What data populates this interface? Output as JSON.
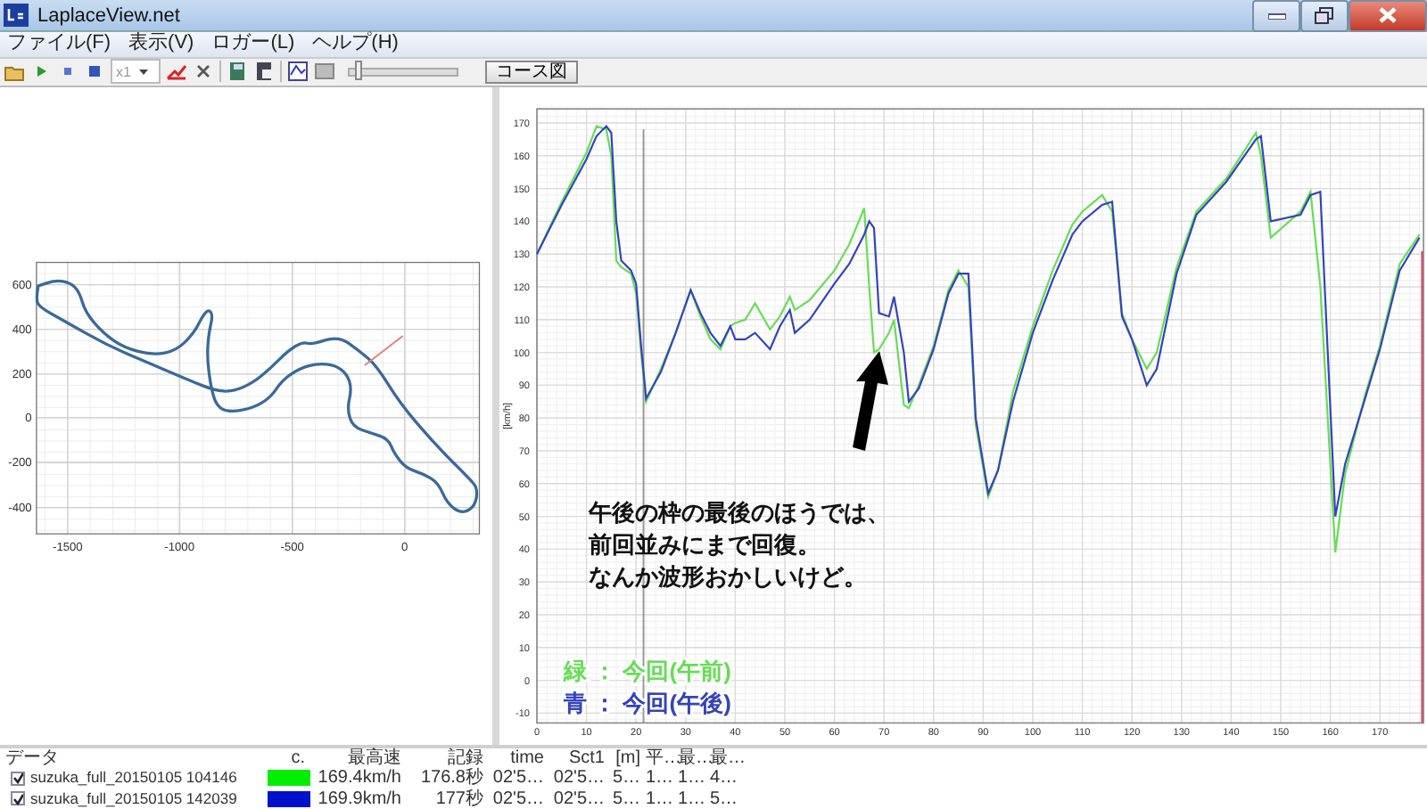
{
  "window": {
    "title": "LaplaceView.net"
  },
  "menu": [
    {
      "label": "ファイル(F)"
    },
    {
      "label": "表示(V)"
    },
    {
      "label": "ロガー(L)"
    },
    {
      "label": "ヘルプ(H)"
    }
  ],
  "toolbar": {
    "zoom_select": "x1",
    "slider": {
      "level": 0.05
    },
    "course_button": "コース図"
  },
  "track_map": {
    "xticks": [
      "-1500",
      "-1000",
      "-500",
      "0"
    ],
    "yticks": [
      "600",
      "400",
      "200",
      "0",
      "-200",
      "-400"
    ]
  },
  "speed_chart": {
    "chart_data": {
      "type": "line",
      "ylabel": "[km/h]",
      "grid": true,
      "ref_lines": [
        {
          "axis": "x",
          "value": 21.5,
          "color": "#999999"
        },
        {
          "axis": "x",
          "value": 178.5,
          "color": "#d04060"
        }
      ],
      "xlim": [
        0,
        178.8
      ],
      "ylim": [
        -13,
        174.3
      ],
      "xticks": [
        0,
        10,
        20,
        30,
        40,
        50,
        60,
        70,
        80,
        90,
        100,
        110,
        120,
        130,
        140,
        150,
        160,
        170
      ],
      "yticks": [
        -10,
        0,
        10,
        20,
        30,
        40,
        50,
        60,
        70,
        80,
        90,
        100,
        110,
        120,
        130,
        140,
        150,
        160,
        170
      ],
      "x": [
        0,
        5,
        10,
        12,
        14,
        15,
        16,
        17,
        19,
        20,
        21,
        22,
        25,
        28,
        31,
        33,
        35,
        37,
        39,
        40,
        42,
        44,
        47,
        49,
        51,
        52,
        55,
        60,
        63,
        66,
        67,
        68,
        69,
        71,
        72,
        74,
        75,
        77,
        80,
        83,
        85,
        87,
        88.5,
        91,
        93,
        96,
        100,
        104,
        108,
        110,
        114,
        116,
        118,
        120,
        123,
        125,
        129,
        133,
        139,
        145,
        146,
        148,
        154,
        156,
        158,
        161,
        163,
        167,
        170,
        174,
        178
      ],
      "series": [
        {
          "name": "今回(午前)",
          "color": "#66dd55",
          "values": [
            130,
            146,
            161,
            169,
            168,
            160,
            128,
            126,
            124,
            118,
            100,
            85,
            95,
            106,
            119,
            111,
            104,
            101,
            108,
            109,
            110,
            115,
            107,
            111,
            117,
            113,
            116,
            125,
            133,
            144,
            120,
            100,
            101,
            106,
            110,
            84,
            83,
            90,
            102,
            119,
            125,
            120,
            78,
            56,
            64,
            88,
            108,
            125,
            139,
            143,
            148,
            143,
            112,
            104,
            95,
            100,
            126,
            143,
            153,
            167,
            160,
            135,
            143,
            149,
            120,
            39,
            63,
            87,
            102,
            127,
            136
          ]
        },
        {
          "name": "今回(午後)",
          "color": "#3344bb",
          "values": [
            130,
            145,
            159,
            166,
            169,
            167,
            140,
            128,
            125,
            121,
            102,
            86,
            94,
            106,
            119,
            112,
            106,
            102,
            108,
            104,
            104,
            106,
            101,
            108,
            113,
            106,
            110,
            121,
            127,
            136,
            140,
            138,
            112,
            111,
            117,
            100,
            85,
            89,
            101,
            118,
            124,
            124,
            80,
            57,
            64,
            85,
            106,
            122,
            136,
            140,
            145,
            146,
            111,
            104,
            90,
            95,
            124,
            142,
            152,
            165,
            166,
            140,
            142,
            148,
            149,
            50,
            66,
            86,
            101,
            125,
            135
          ]
        }
      ]
    },
    "note": [
      "午後の枠の最後のほうでは、",
      "前回並みにまで回復。",
      "なんか波形おかしいけど。"
    ],
    "legend_keys": [
      "緑 ：",
      "青 ："
    ]
  },
  "table": {
    "columns": [
      "データ",
      "c.",
      "最高速",
      "記録",
      "time",
      "Sct1",
      "[m]",
      "平…",
      "最…",
      "最…"
    ],
    "rows": [
      {
        "checked": true,
        "color": "#00ee00",
        "cells": [
          "suzuka_full_20150105 104146",
          "",
          "169.4km/h",
          "176.8秒",
          "02'5…",
          "02'5…",
          "5…",
          "1…",
          "1…",
          "4…"
        ]
      },
      {
        "checked": true,
        "color": "#0011cc",
        "cells": [
          "suzuka_full_20150105 142039",
          "",
          "169.9km/h",
          "177秒",
          "02'5…",
          "02'5…",
          "5…",
          "1…",
          "1…",
          "5…"
        ]
      }
    ]
  }
}
